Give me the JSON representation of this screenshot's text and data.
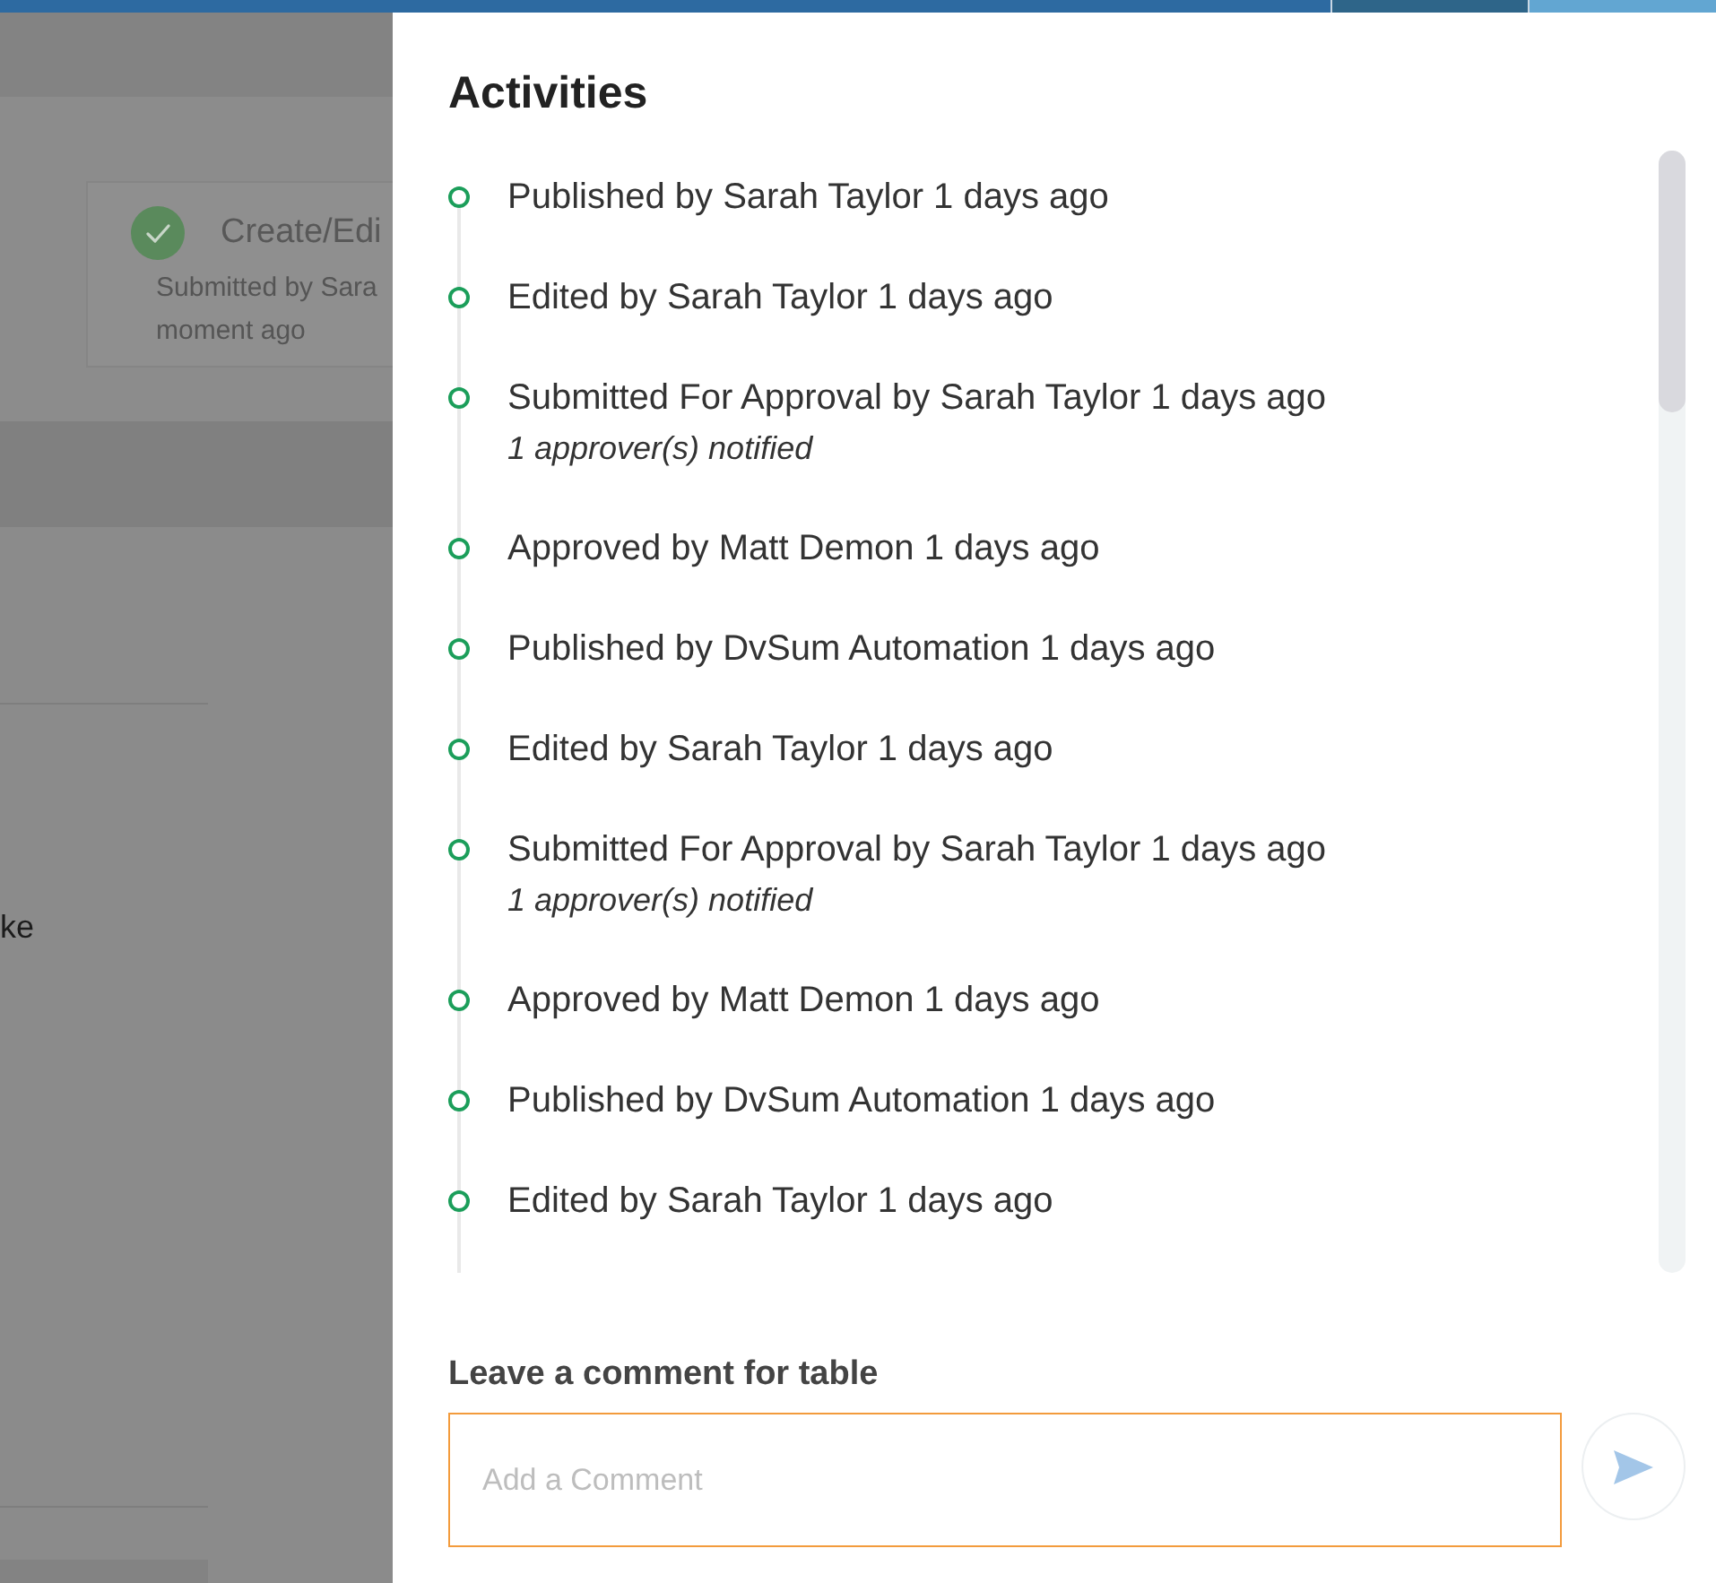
{
  "background_page": {
    "card": {
      "title": "Create/Edi",
      "subtitle_lines": [
        "Submitted by Sara",
        "moment ago"
      ]
    },
    "fragment_text": "ke"
  },
  "activities_panel": {
    "title": "Activities",
    "items": [
      {
        "text": "Published by Sarah Taylor 1 days ago"
      },
      {
        "text": "Edited by Sarah Taylor 1 days ago"
      },
      {
        "text": "Submitted For Approval by Sarah Taylor 1 days ago",
        "note": "1 approver(s) notified"
      },
      {
        "text": "Approved by Matt Demon 1 days ago"
      },
      {
        "text": "Published by DvSum Automation 1 days ago"
      },
      {
        "text": "Edited by Sarah Taylor 1 days ago"
      },
      {
        "text": "Submitted For Approval by Sarah Taylor 1 days ago",
        "note": "1 approver(s) notified"
      },
      {
        "text": "Approved by Matt Demon 1 days ago"
      },
      {
        "text": "Published by DvSum Automation 1 days ago"
      },
      {
        "text": "Edited by Sarah Taylor 1 days ago"
      }
    ],
    "comment": {
      "label": "Leave a comment for table",
      "placeholder": "Add a Comment",
      "focused": true
    },
    "send_button": {
      "disabled": true
    }
  }
}
